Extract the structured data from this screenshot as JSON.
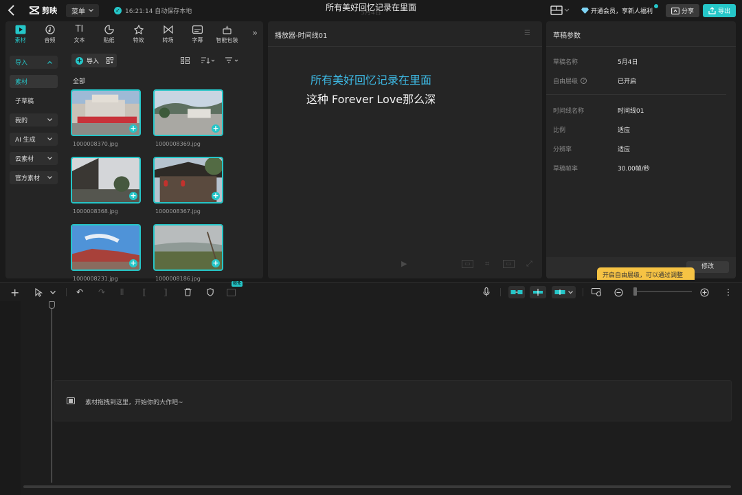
{
  "topbar": {
    "logo_text": "剪映",
    "menu_label": "菜单",
    "autosave_text": "16:21:14 自动保存本地",
    "project_title": "所有美好回忆记录在里面",
    "project_date": "5月4日",
    "vip_text": "开通会员，享新人福利",
    "share_label": "分享",
    "export_label": "导出"
  },
  "tool_tabs": [
    {
      "label": "素材",
      "icon": "media-icon",
      "active": true
    },
    {
      "label": "音频",
      "icon": "audio-icon",
      "active": false
    },
    {
      "label": "文本",
      "icon": "text-icon",
      "active": false
    },
    {
      "label": "贴纸",
      "icon": "sticker-icon",
      "active": false
    },
    {
      "label": "特效",
      "icon": "effects-icon",
      "active": false
    },
    {
      "label": "转场",
      "icon": "transition-icon",
      "active": false
    },
    {
      "label": "字幕",
      "icon": "subtitle-icon",
      "active": false
    },
    {
      "label": "智能包装",
      "icon": "smart-pack-icon",
      "active": false
    }
  ],
  "categories": [
    {
      "label": "导入",
      "chevron": "up"
    },
    {
      "label": "素材",
      "chevron": ""
    },
    {
      "label": "子草稿",
      "chevron": ""
    },
    {
      "label": "我的",
      "chevron": "down"
    },
    {
      "label": "AI 生成",
      "chevron": "down"
    },
    {
      "label": "云素材",
      "chevron": "down"
    },
    {
      "label": "官方素材",
      "chevron": "down"
    }
  ],
  "media": {
    "import_label": "导入",
    "section_label": "全部",
    "items": [
      {
        "name": "1000008370.jpg"
      },
      {
        "name": "1000008369.jpg"
      },
      {
        "name": "1000008368.jpg"
      },
      {
        "name": "1000008367.jpg"
      },
      {
        "name": "1000008231.jpg"
      },
      {
        "name": "1000008186.jpg"
      }
    ]
  },
  "player": {
    "title": "播放器-时间线01",
    "caption_line1": "所有美好回忆记录在里面",
    "caption_line2": "这种 Forever Love那么深"
  },
  "properties": {
    "title": "草稿参数",
    "rows": [
      {
        "label": "草稿名称",
        "value": "5月4日"
      },
      {
        "label": "自由层级",
        "value": "已开启"
      },
      {
        "label": "时间线名称",
        "value": "时间线01"
      },
      {
        "label": "比例",
        "value": "适应"
      },
      {
        "label": "分辨率",
        "value": "适应"
      },
      {
        "label": "草稿帧率",
        "value": "30.00帧/秒"
      }
    ],
    "modify_label": "修改",
    "tooltip_text": "开启自由层级，可以通过调整"
  },
  "timeline": {
    "free_badge": "限免",
    "drop_hint": "素材拖拽到这里，开始你的大作吧~"
  },
  "colors": {
    "accent": "#25c6c8",
    "caption_blue": "#3db9e4",
    "tooltip_yellow": "#f6c344"
  }
}
